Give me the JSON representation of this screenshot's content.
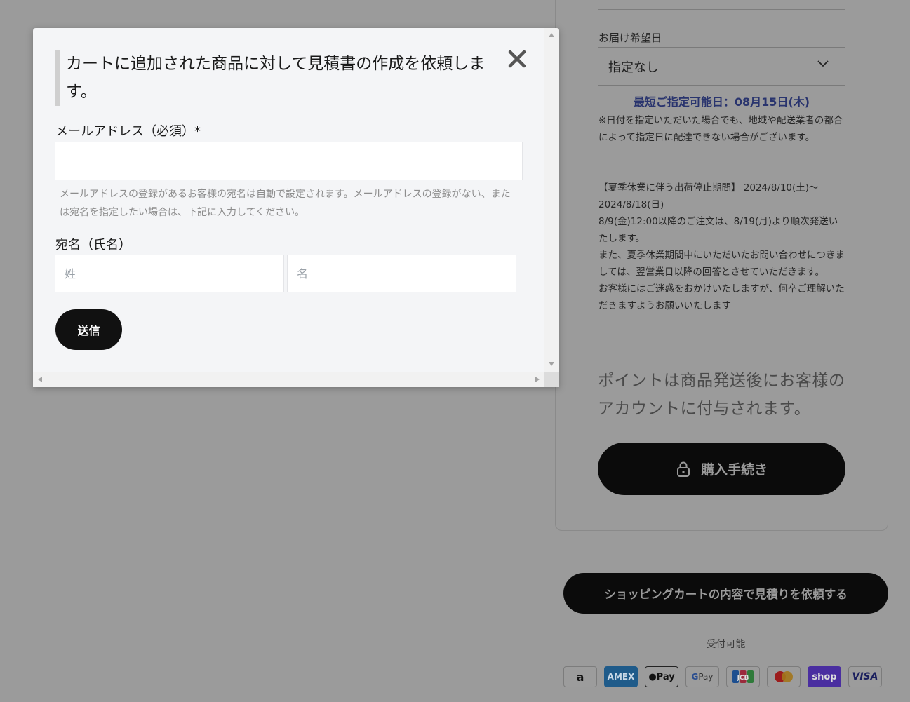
{
  "modal": {
    "heading": "カートに追加された商品に対して見積書の作成を依頼します。",
    "email_label": "メールアドレス（必須）*",
    "email_value": "",
    "help_text": "メールアドレスの登録があるお客様の宛名は自動で設定されます。メールアドレスの登録がない、または宛名を指定したい場合は、下記に入力してください。",
    "name_label": "宛名（氏名）",
    "last_name_placeholder": "姓",
    "first_name_placeholder": "名",
    "submit_label": "送信",
    "close_icon": "close-icon"
  },
  "delivery": {
    "label": "お届け希望日",
    "selected": "指定なし",
    "earliest": "最短ご指定可能日：08月15日(木)",
    "notice_1": "※日付を指定いただいた場合でも、地域や配送業者の都合によって指定日に配達できない場合がございます。",
    "notice_2_lines": [
      "【夏季休業に伴う出荷停止期間】 2024/8/10(土)〜2024/8/18(日)",
      "8/9(金)12:00以降のご注文は、8/19(月)より順次発送いたします。",
      "また、夏季休業期間中にいただいたお問い合わせにつきましては、翌営業日以降の回答とさせていただきます。",
      "お客様にはご迷惑をおかけいたしますが、何卒ご理解いただきますようお願いいたします"
    ]
  },
  "points_text": "ポイントは商品発送後にお客様のアカウントに付与されます。",
  "checkout_label": "購入手続き",
  "quote_button_label": "ショッピングカートの内容で見積りを依頼する",
  "accepts_label": "受付可能",
  "payment_methods": {
    "amazon": "a",
    "amex": "AMEX",
    "apple_pay": "Pay",
    "google_pay": "Pay",
    "jcb": "JCB",
    "mastercard": "mastercard",
    "shop": "shop",
    "visa": "VISA"
  },
  "colors": {
    "overlay": "#9b9b9b",
    "button_dark": "#0b0b0b",
    "earliest_date": "#29346e",
    "modal_bg": "#f4f5f7"
  }
}
